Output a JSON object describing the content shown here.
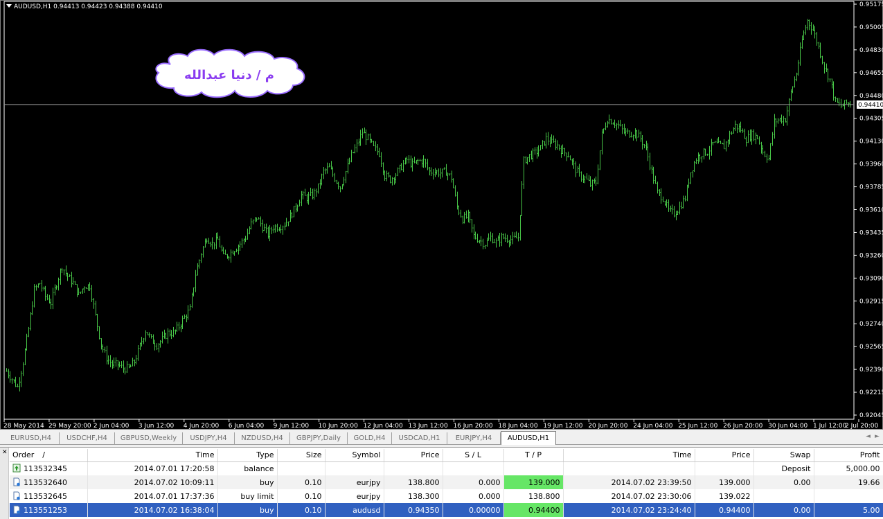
{
  "chart": {
    "header": "AUDUSD,H1  0.94413 0.94423 0.94388 0.94410",
    "watermark_text": "م / دنيا عبدالله",
    "current_price_label": "0.94410",
    "colors": {
      "background": "#000000",
      "bars": "#48c848",
      "text": "#ffffff",
      "current_line": "#9a9a9a"
    }
  },
  "chart_data": {
    "type": "ohlc-bar",
    "symbol": "AUDUSD",
    "timeframe": "H1",
    "ylim": [
      0.92045,
      0.95175
    ],
    "y_ticks": [
      "0.95175",
      "0.95005",
      "0.94830",
      "0.94655",
      "0.94480",
      "0.94305",
      "0.94130",
      "0.93960",
      "0.93785",
      "0.93610",
      "0.93435",
      "0.93260",
      "0.93090",
      "0.92915",
      "0.92740",
      "0.92565",
      "0.92390",
      "0.92215",
      "0.92045"
    ],
    "x_ticks": [
      "28 May 2014",
      "29 May 20:00",
      "2 Jun 04:00",
      "3 Jun 12:00",
      "4 Jun 20:00",
      "6 Jun 04:00",
      "9 Jun 12:00",
      "10 Jun 20:00",
      "12 Jun 04:00",
      "13 Jun 12:00",
      "16 Jun 20:00",
      "18 Jun 04:00",
      "19 Jun 12:00",
      "20 Jun 20:00",
      "24 Jun 04:00",
      "25 Jun 12:00",
      "26 Jun 20:00",
      "30 Jun 04:00",
      "1 Jul 12:00",
      "2 Jul 20:00"
    ],
    "current_price": 0.9441,
    "close_path": [
      [
        0,
        0.9238
      ],
      [
        3,
        0.9232
      ],
      [
        6,
        0.9226
      ],
      [
        9,
        0.9245
      ],
      [
        12,
        0.927
      ],
      [
        15,
        0.93
      ],
      [
        18,
        0.9305
      ],
      [
        21,
        0.9295
      ],
      [
        24,
        0.929
      ],
      [
        27,
        0.9305
      ],
      [
        30,
        0.9318
      ],
      [
        33,
        0.931
      ],
      [
        36,
        0.9305
      ],
      [
        39,
        0.9296
      ],
      [
        42,
        0.9303
      ],
      [
        45,
        0.9303
      ],
      [
        48,
        0.928
      ],
      [
        51,
        0.9258
      ],
      [
        54,
        0.9248
      ],
      [
        57,
        0.9243
      ],
      [
        60,
        0.9243
      ],
      [
        63,
        0.924
      ],
      [
        66,
        0.924
      ],
      [
        69,
        0.9245
      ],
      [
        72,
        0.9257
      ],
      [
        75,
        0.9269
      ],
      [
        78,
        0.9262
      ],
      [
        81,
        0.9258
      ],
      [
        84,
        0.9262
      ],
      [
        87,
        0.9267
      ],
      [
        90,
        0.9267
      ],
      [
        93,
        0.9272
      ],
      [
        96,
        0.9279
      ],
      [
        99,
        0.9285
      ],
      [
        102,
        0.9312
      ],
      [
        105,
        0.9328
      ],
      [
        108,
        0.934
      ],
      [
        111,
        0.9335
      ],
      [
        114,
        0.9338
      ],
      [
        117,
        0.9325
      ],
      [
        120,
        0.9327
      ],
      [
        123,
        0.9331
      ],
      [
        126,
        0.9335
      ],
      [
        129,
        0.934
      ],
      [
        132,
        0.935
      ],
      [
        135,
        0.9355
      ],
      [
        138,
        0.9348
      ],
      [
        141,
        0.9342
      ],
      [
        144,
        0.9348
      ],
      [
        147,
        0.9348
      ],
      [
        150,
        0.935
      ],
      [
        153,
        0.9356
      ],
      [
        156,
        0.9363
      ],
      [
        159,
        0.9372
      ],
      [
        162,
        0.937
      ],
      [
        165,
        0.9372
      ],
      [
        168,
        0.9378
      ],
      [
        171,
        0.939
      ],
      [
        174,
        0.9393
      ],
      [
        177,
        0.9385
      ],
      [
        180,
        0.9378
      ],
      [
        183,
        0.939
      ],
      [
        186,
        0.9402
      ],
      [
        189,
        0.941
      ],
      [
        192,
        0.942
      ],
      [
        195,
        0.9415
      ],
      [
        198,
        0.9408
      ],
      [
        201,
        0.9404
      ],
      [
        204,
        0.9387
      ],
      [
        207,
        0.9384
      ],
      [
        210,
        0.9388
      ],
      [
        213,
        0.9394
      ],
      [
        216,
        0.9399
      ],
      [
        219,
        0.9395
      ],
      [
        222,
        0.9398
      ],
      [
        225,
        0.9398
      ],
      [
        228,
        0.939
      ],
      [
        231,
        0.939
      ],
      [
        234,
        0.9389
      ],
      [
        237,
        0.939
      ],
      [
        240,
        0.9385
      ],
      [
        243,
        0.9363
      ],
      [
        246,
        0.9354
      ],
      [
        249,
        0.9356
      ],
      [
        252,
        0.9341
      ],
      [
        255,
        0.9338
      ],
      [
        258,
        0.9335
      ],
      [
        261,
        0.934
      ],
      [
        264,
        0.9336
      ],
      [
        267,
        0.934
      ],
      [
        270,
        0.9339
      ],
      [
        273,
        0.9338
      ],
      [
        276,
        0.934
      ],
      [
        279,
        0.9398
      ],
      [
        282,
        0.9402
      ],
      [
        285,
        0.9404
      ],
      [
        288,
        0.9408
      ],
      [
        291,
        0.9415
      ],
      [
        294,
        0.9412
      ],
      [
        297,
        0.941
      ],
      [
        300,
        0.9405
      ],
      [
        303,
        0.9403
      ],
      [
        306,
        0.9394
      ],
      [
        309,
        0.9387
      ],
      [
        312,
        0.9385
      ],
      [
        315,
        0.938
      ],
      [
        318,
        0.9382
      ],
      [
        321,
        0.9418
      ],
      [
        324,
        0.943
      ],
      [
        327,
        0.9428
      ],
      [
        330,
        0.9425
      ],
      [
        333,
        0.942
      ],
      [
        336,
        0.9419
      ],
      [
        339,
        0.942
      ],
      [
        342,
        0.9415
      ],
      [
        345,
        0.9407
      ],
      [
        348,
        0.939
      ],
      [
        351,
        0.9374
      ],
      [
        354,
        0.937
      ],
      [
        357,
        0.936
      ],
      [
        360,
        0.9358
      ],
      [
        363,
        0.9363
      ],
      [
        366,
        0.937
      ],
      [
        369,
        0.939
      ],
      [
        372,
        0.94
      ],
      [
        375,
        0.9404
      ],
      [
        378,
        0.9405
      ],
      [
        381,
        0.9411
      ],
      [
        384,
        0.941
      ],
      [
        387,
        0.9409
      ],
      [
        390,
        0.9418
      ],
      [
        393,
        0.9425
      ],
      [
        396,
        0.9422
      ],
      [
        399,
        0.9415
      ],
      [
        402,
        0.9418
      ],
      [
        405,
        0.9416
      ],
      [
        408,
        0.9405
      ],
      [
        411,
        0.94
      ],
      [
        414,
        0.9428
      ],
      [
        417,
        0.943
      ],
      [
        420,
        0.943
      ],
      [
        423,
        0.945
      ],
      [
        426,
        0.9465
      ],
      [
        429,
        0.949
      ],
      [
        432,
        0.9505
      ],
      [
        435,
        0.9498
      ],
      [
        438,
        0.9485
      ],
      [
        441,
        0.947
      ],
      [
        444,
        0.946
      ],
      [
        447,
        0.9443
      ],
      [
        450,
        0.944
      ],
      [
        453,
        0.9442
      ]
    ],
    "approx_num_bars": 456
  },
  "tabs": {
    "items": [
      {
        "label": "EURUSD,H4",
        "active": false
      },
      {
        "label": "USDCHF,H4",
        "active": false
      },
      {
        "label": "GBPUSD,Weekly",
        "active": false
      },
      {
        "label": "USDJPY,H4",
        "active": false
      },
      {
        "label": "NZDUSD,H4",
        "active": false
      },
      {
        "label": "GBPJPY,Daily",
        "active": false
      },
      {
        "label": "GOLD,H4",
        "active": false
      },
      {
        "label": "USDCAD,H1",
        "active": false
      },
      {
        "label": "EURJPY,H4",
        "active": false
      },
      {
        "label": "AUDUSD,H1",
        "active": true
      }
    ],
    "scroll_left": "◄",
    "scroll_right": "►"
  },
  "terminal": {
    "close_glyph": "✕",
    "columns": [
      "Order",
      "/",
      "Time",
      "Type",
      "Size",
      "Symbol",
      "Price",
      "S / L",
      "T / P",
      "Time",
      "Price",
      "Swap",
      "Profit"
    ],
    "rows": [
      {
        "icon": "deposit-icon",
        "order": "113532345",
        "time": "2014.07.01 17:20:58",
        "type": "balance",
        "size": "",
        "symbol": "",
        "price": "",
        "sl": "",
        "tp": "",
        "close_time": "",
        "close_price": "",
        "swap": "Deposit",
        "profit": "5,000.00",
        "tp_hit": false,
        "selected": false
      },
      {
        "icon": "closed-order-icon",
        "order": "113532640",
        "time": "2014.07.02 10:09:11",
        "type": "buy",
        "size": "0.10",
        "symbol": "eurjpy",
        "price": "138.800",
        "sl": "0.000",
        "tp": "139.000",
        "close_time": "2014.07.02 23:39:50",
        "close_price": "139.000",
        "swap": "0.00",
        "profit": "19.66",
        "tp_hit": true,
        "selected": false
      },
      {
        "icon": "closed-order-icon",
        "order": "113532645",
        "time": "2014.07.01 17:37:36",
        "type": "buy limit",
        "size": "0.10",
        "symbol": "eurjpy",
        "price": "138.300",
        "sl": "0.000",
        "tp": "138.800",
        "close_time": "2014.07.02 23:30:06",
        "close_price": "139.022",
        "swap": "",
        "profit": "",
        "tp_hit": false,
        "selected": false
      },
      {
        "icon": "closed-order-icon",
        "order": "113551253",
        "time": "2014.07.02 16:38:04",
        "type": "buy",
        "size": "0.10",
        "symbol": "audusd",
        "price": "0.94350",
        "sl": "0.00000",
        "tp": "0.94400",
        "close_time": "2014.07.02 23:24:40",
        "close_price": "0.94400",
        "swap": "0.00",
        "profit": "5.00",
        "tp_hit": true,
        "selected": true
      }
    ]
  }
}
